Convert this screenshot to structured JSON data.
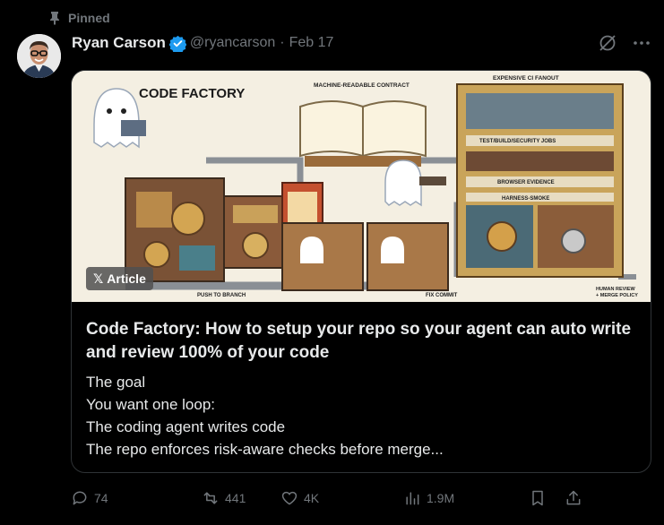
{
  "pinned": {
    "label": "Pinned"
  },
  "author": {
    "name": "Ryan Carson",
    "handle": "@ryancarson",
    "date": "Feb 17"
  },
  "article": {
    "badge": "Article",
    "image_lettering": [
      "CODE FACTORY",
      "MACHINE-READABLE CONTRACT",
      "EXPENSIVE CI FANOUT",
      "TEST/BUILD/SECURITY JOBS",
      "BROWSER EVIDENCE",
      "HARNESS-SMOKE",
      "PUSH TO BRANCH",
      "FIX COMMIT",
      "HUMAN REVIEW + MERGE POLICY"
    ],
    "title": "Code Factory: How to setup your repo so your agent can auto write and review 100% of your code",
    "lines": [
      "The goal",
      "You want one loop:",
      "The coding agent writes code",
      "The repo enforces risk-aware checks before merge..."
    ]
  },
  "actions": {
    "replies": "74",
    "reposts": "441",
    "likes": "4K",
    "views": "1.9M"
  },
  "icons": [
    "pin-icon",
    "verified-badge-icon",
    "grok-icon",
    "more-icon",
    "reply-icon",
    "repost-icon",
    "like-icon",
    "views-icon",
    "bookmark-icon",
    "share-icon"
  ],
  "colors": {
    "background": "#000000",
    "text": "#e7e9ea",
    "muted": "#71767b",
    "border": "#2f3336",
    "verified": "#1d9bf0"
  }
}
